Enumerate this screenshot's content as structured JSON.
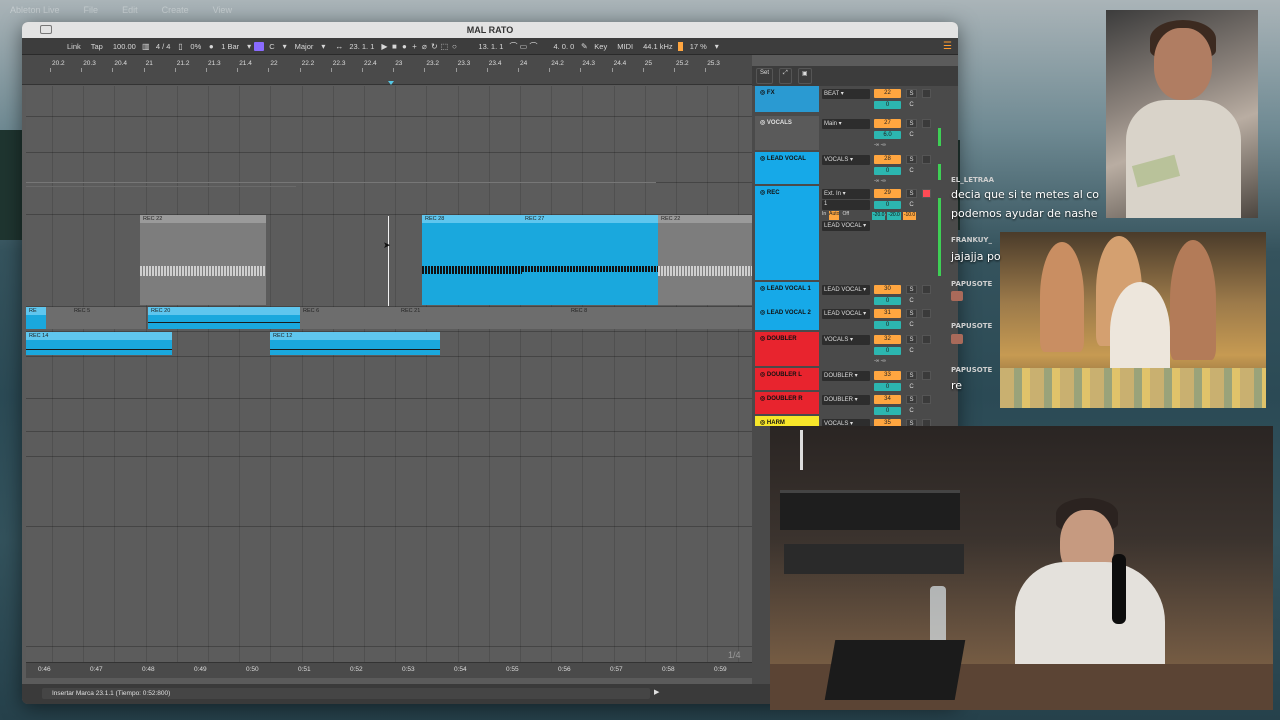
{
  "desktop": {
    "menubar": [
      "Ableton Live",
      "File",
      "Edit",
      "Create",
      "View"
    ]
  },
  "window": {
    "title": "MAL RATO"
  },
  "toolbar": {
    "link": "Link",
    "tap": "Tap",
    "tempo": "100.00",
    "meter_icon": "metronome-icon",
    "signature": "4 / 4",
    "swing": "0%",
    "quant": "1 Bar",
    "key_root": "C",
    "key_scale": "Major",
    "position": "23.  1.  1",
    "loop_start": "13.  1.  1",
    "loop_len": "4.  0.  0",
    "key": "Key",
    "midi": "MIDI",
    "sample_rate": "44.1 kHz",
    "cpu": "17 %"
  },
  "ruler": {
    "ticks": [
      "20.2",
      "20.3",
      "20.4",
      "21",
      "21.2",
      "21.3",
      "21.4",
      "22",
      "22.2",
      "22.3",
      "22.4",
      "23",
      "23.2",
      "23.3",
      "23.4",
      "24",
      "24.2",
      "24.3",
      "24.4",
      "25",
      "25.2",
      "25.3"
    ]
  },
  "time": {
    "ticks": [
      "0:46",
      "0:47",
      "0:48",
      "0:49",
      "0:50",
      "0:51",
      "0:52",
      "0:53",
      "0:54",
      "0:55",
      "0:56",
      "0:57",
      "0:58",
      "0:59"
    ]
  },
  "clips": {
    "rec22a": "REC 22",
    "rec28": "REC 28",
    "rec27": "REC 27",
    "rec22b": "REC 22",
    "recA": "RE",
    "rec5": "REC 5",
    "rec20": "REC 20",
    "rec6": "REC 6",
    "rec21": "REC 21",
    "rec8": "REC 8",
    "rec14": "REC 14",
    "rec12": "REC 12"
  },
  "page_indicator": "1/4",
  "status": {
    "text": "Insertar Marca 23.1.1 (Tiempo: 0:52:800)"
  },
  "mixer": {
    "set_label": "Set",
    "tracks": [
      {
        "name": "FX",
        "route": "BEAT",
        "vol": "22",
        "pan": "0",
        "color": "#2a9ad2"
      },
      {
        "name": "VOCALS",
        "route": "Main",
        "vol": "27",
        "pan": "6.0",
        "color": "#5a5a5a"
      },
      {
        "name": "LEAD VOCAL",
        "route": "VOCALS",
        "vol": "28",
        "pan": "0",
        "color": "#16a9e8"
      },
      {
        "name": "REC",
        "route": "Ext. In",
        "sub_route": "1",
        "route2": "LEAD VOCAL",
        "in": "In",
        "auto": "Auto",
        "off": "Off",
        "vol": "29",
        "pan": "0",
        "db1": "-20.0",
        "db2": "-20.0",
        "db3": "-10.0",
        "color": "#16a9e8"
      },
      {
        "name": "LEAD VOCAL 1",
        "route": "LEAD VOCAL",
        "vol": "30",
        "pan": "0",
        "color": "#16a9e8"
      },
      {
        "name": "LEAD VOCAL 2",
        "route": "LEAD VOCAL",
        "vol": "31",
        "pan": "0",
        "color": "#16a9e8"
      },
      {
        "name": "DOUBLER",
        "route": "VOCALS",
        "vol": "32",
        "pan": "0",
        "color": "#e8242e"
      },
      {
        "name": "DOUBLER L",
        "route": "DOUBLER",
        "vol": "33",
        "pan": "0",
        "color": "#e8242e"
      },
      {
        "name": "DOUBLER R",
        "route": "DOUBLER",
        "vol": "34",
        "pan": "0",
        "color": "#e8242e"
      },
      {
        "name": "HARM",
        "route": "VOCALS",
        "vol": "35",
        "pan": "0",
        "color": "#f7e62a"
      }
    ],
    "s_label": "S",
    "c_label": "C",
    "minus_inf": "-∞"
  },
  "chat": [
    {
      "user": "EL_LETRAA",
      "user_color": "#b48cff",
      "msg1": "decia que si te metes al co",
      "msg2": "podemos ayudar de nashe"
    },
    {
      "user": "FRANKUY_",
      "user_color": "#d84040",
      "msg1": "jajajja po"
    },
    {
      "user": "PAPUSOTE",
      "user_color": "#e0902c"
    },
    {
      "user": "PAPUSOTE",
      "user_color": "#e0902c"
    },
    {
      "user": "PAPUSOTE",
      "user_color": "#e0902c",
      "msg1": "re"
    }
  ]
}
